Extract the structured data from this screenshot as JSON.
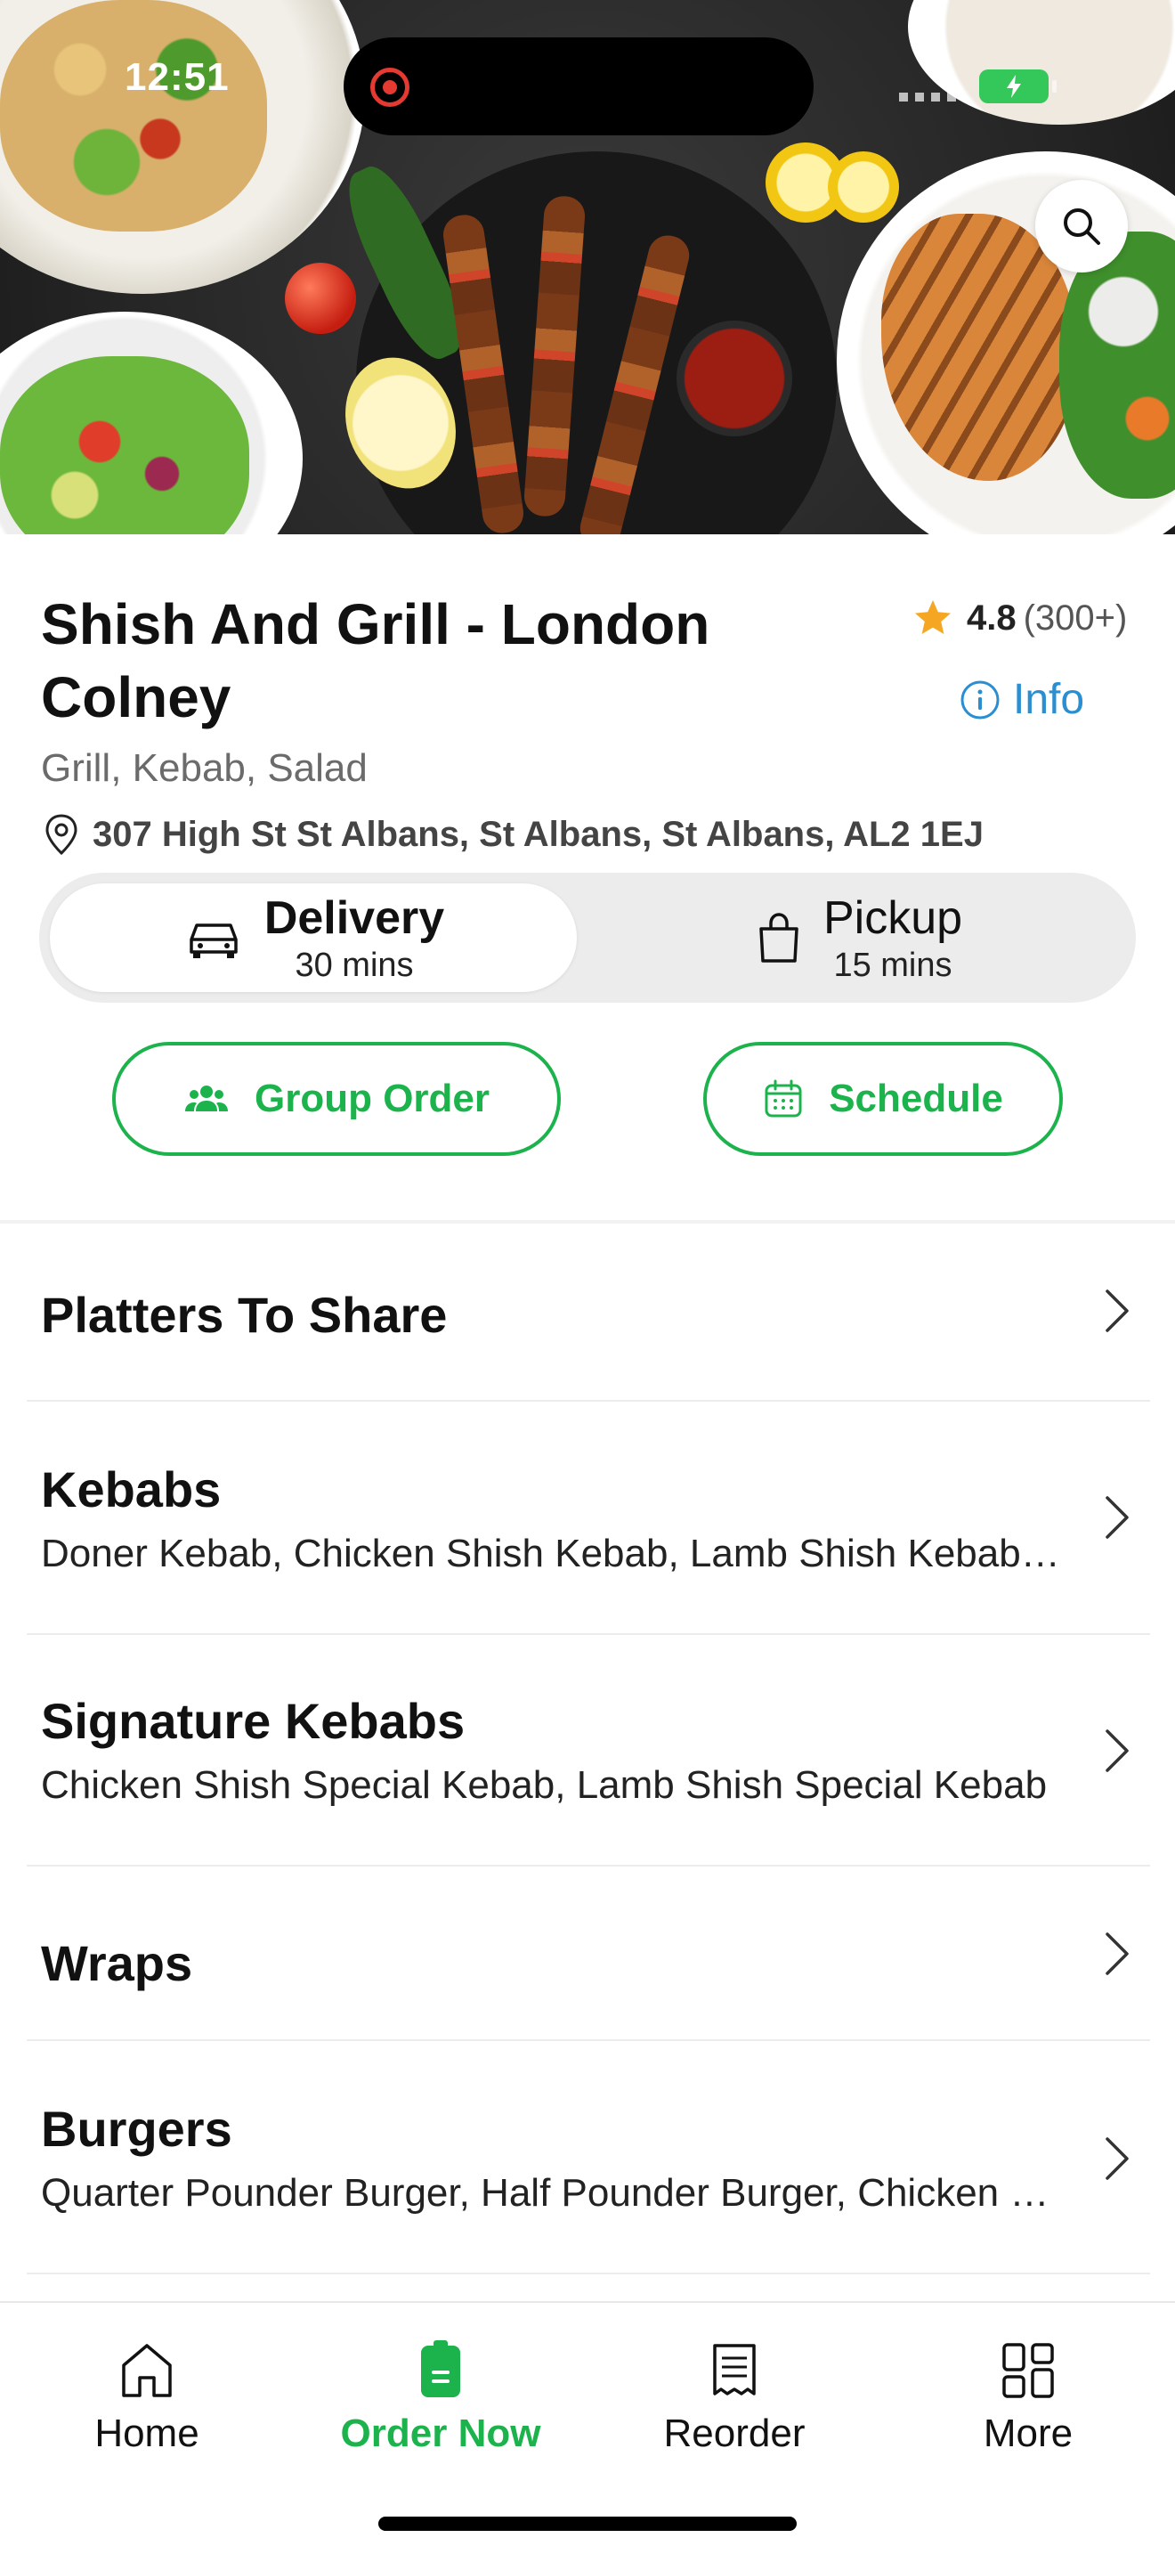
{
  "status_bar": {
    "time": "12:51"
  },
  "restaurant": {
    "name": "Shish And Grill - London Colney",
    "rating": "4.8",
    "rating_count": "(300+)",
    "info_label": "Info",
    "cuisines": "Grill, Kebab, Salad",
    "address": "307 High St St Albans, St Albans, St Albans, AL2 1EJ"
  },
  "order_type": {
    "delivery": {
      "label": "Delivery",
      "time": "30 mins",
      "selected": true
    },
    "pickup": {
      "label": "Pickup",
      "time": "15 mins",
      "selected": false
    }
  },
  "actions": {
    "group_order": "Group Order",
    "schedule": "Schedule"
  },
  "menu_categories": [
    {
      "name": "Platters To Share",
      "description": ""
    },
    {
      "name": "Kebabs",
      "description": "Doner Kebab, Chicken Shish Kebab, Lamb Shish Kebab, Mixed Kebab"
    },
    {
      "name": "Signature Kebabs",
      "description": "Chicken Shish Special Kebab, Lamb Shish Special Kebab"
    },
    {
      "name": "Wraps",
      "description": ""
    },
    {
      "name": "Burgers",
      "description": "Quarter Pounder Burger, Half Pounder Burger, Chicken Burger"
    }
  ],
  "tab_bar": {
    "tabs": [
      {
        "label": "Home",
        "icon": "home-icon",
        "active": false
      },
      {
        "label": "Order Now",
        "icon": "order-now-icon",
        "active": true
      },
      {
        "label": "Reorder",
        "icon": "receipt-icon",
        "active": false
      },
      {
        "label": "More",
        "icon": "grid-icon",
        "active": false
      }
    ]
  },
  "colors": {
    "accent": "#1cb34c",
    "link": "#2a8ed0",
    "star": "#f5a623"
  }
}
